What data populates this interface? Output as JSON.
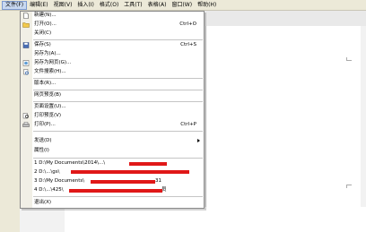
{
  "menubar": {
    "items": [
      "文件(F)",
      "编辑(E)",
      "视图(V)",
      "插入(I)",
      "格式(O)",
      "工具(T)",
      "表格(A)",
      "窗口(W)",
      "帮助(H)"
    ]
  },
  "file_menu": {
    "new": "新建(N)...",
    "open": "打开(O)...",
    "open_shortcut": "Ctrl+O",
    "close": "关闭(C)",
    "save": "保存(S)",
    "save_shortcut": "Ctrl+S",
    "save_as": "另存为(A)...",
    "save_as_web": "另存为网页(G)...",
    "file_search": "文件搜索(H)...",
    "versions": "版本(R)...",
    "web_preview": "网页预览(B)",
    "page_setup": "页面设置(U)...",
    "print_preview": "打印预览(V)",
    "print": "打印(P)...",
    "print_shortcut": "Ctrl+P",
    "send_to": "发送(D)",
    "properties": "属性(I)",
    "recent": [
      "1 D:\\My Documents\\2014\\...\\",
      "2 D:\\...\\gs\\",
      "3 D:\\My Documents\\",
      "4 D:\\...\\425\\"
    ],
    "recent_tail": [
      "",
      "",
      "31",
      "员"
    ],
    "exit": "退出(X)"
  },
  "colors": {
    "redaction": "#e01818",
    "menubar": "#ece9d8"
  }
}
